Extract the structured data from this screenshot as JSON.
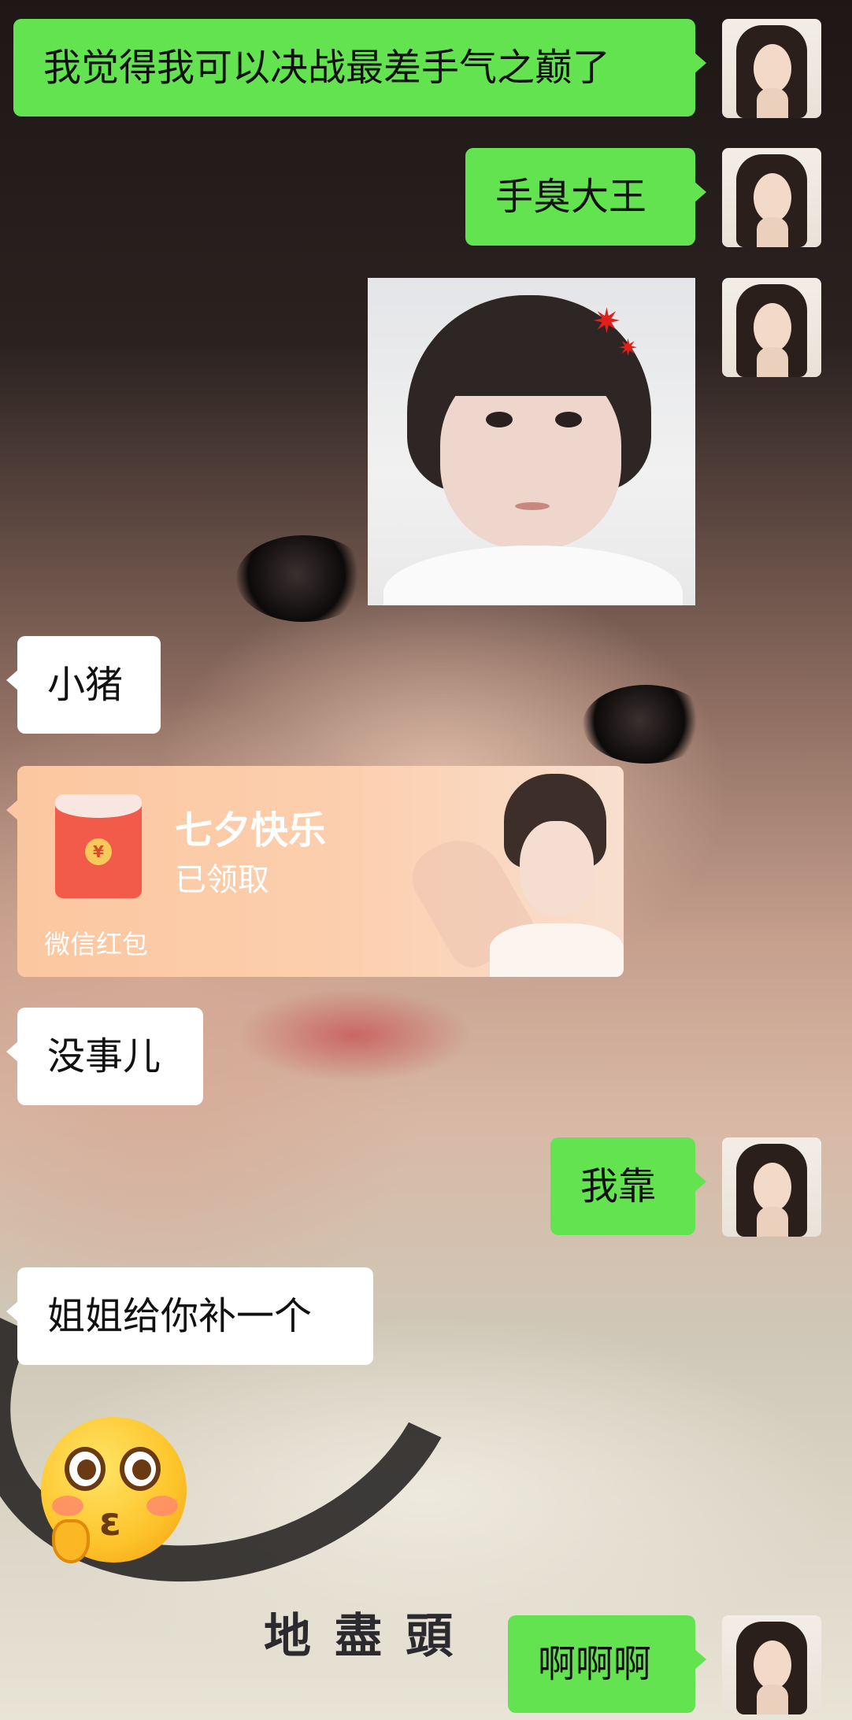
{
  "messages": [
    {
      "side": "out",
      "text": "我觉得我可以决战最差手气之巅了"
    },
    {
      "side": "out",
      "text": "手臭大王"
    },
    {
      "side": "out",
      "type": "sticker-image"
    },
    {
      "side": "in",
      "text": "小猪"
    },
    {
      "side": "in",
      "type": "red-packet"
    },
    {
      "side": "in",
      "text": "没事儿"
    },
    {
      "side": "out",
      "text": "我靠"
    },
    {
      "side": "in",
      "text": "姐姐给你补一个"
    },
    {
      "side": "in",
      "type": "emoji-sticker"
    },
    {
      "side": "out",
      "text": "啊啊啊"
    }
  ],
  "red_packet": {
    "title": "七夕快乐",
    "status": "已领取",
    "label": "微信红包",
    "coin_glyph": "¥"
  },
  "wallpaper_text": "地盡頭",
  "sticker": {
    "anger_mark": "✷"
  },
  "emoji_sticker": {
    "mouth": "ε"
  },
  "colors": {
    "out_bubble": "#64e351",
    "in_bubble": "#ffffff",
    "red_packet_bg": "#fbc7a0"
  }
}
